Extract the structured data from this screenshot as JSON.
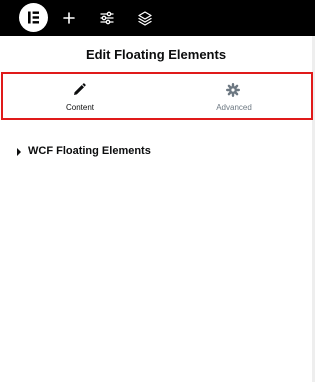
{
  "topbar": {
    "logo_icon": "elementor-logo-icon",
    "add_icon": "plus-icon",
    "settings_icon": "sliders-icon",
    "structure_icon": "layers-icon"
  },
  "panel": {
    "title": "Edit Floating Elements",
    "tabs": [
      {
        "label": "Content",
        "icon": "pencil-icon",
        "active": true
      },
      {
        "label": "Advanced",
        "icon": "gear-icon",
        "active": false
      }
    ],
    "highlight_color": "#e01a1a",
    "section": {
      "title": "WCF Floating Elements",
      "expanded": false
    }
  }
}
